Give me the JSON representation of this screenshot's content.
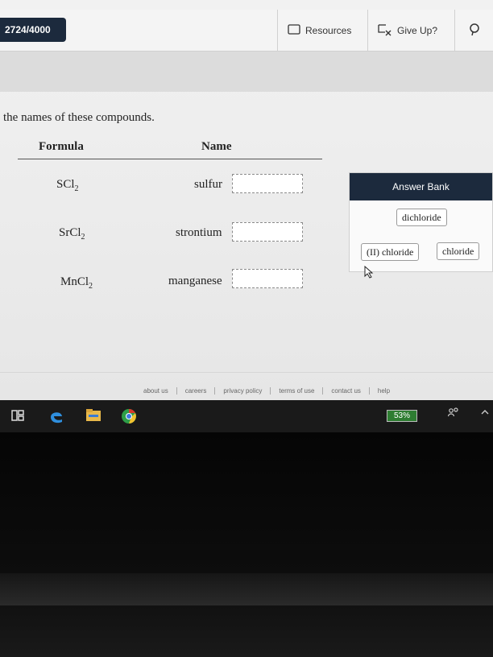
{
  "header": {
    "progress": "2724/4000",
    "resources_label": "Resources",
    "give_up_label": "Give Up?"
  },
  "instruction": "the names of these compounds.",
  "table": {
    "formula_header": "Formula",
    "name_header": "Name",
    "rows": [
      {
        "formula_base": "SCl",
        "formula_sub": "2",
        "name_prefix": "sulfur"
      },
      {
        "formula_base": "SrCl",
        "formula_sub": "2",
        "name_prefix": "strontium"
      },
      {
        "formula_base": "MnCl",
        "formula_sub": "2",
        "name_prefix": "manganese"
      }
    ]
  },
  "answer_bank": {
    "title": "Answer Bank",
    "items": [
      "dichloride",
      "(II) chloride",
      "chloride"
    ]
  },
  "footer": {
    "links": [
      "about us",
      "careers",
      "privacy policy",
      "terms of use",
      "contact us",
      "help"
    ]
  },
  "taskbar": {
    "battery": "53%"
  },
  "colors": {
    "accent_navy": "#1c2a3d",
    "battery_green": "#2e7d32"
  },
  "icons": [
    "folder-icon",
    "give-up-icon",
    "hint-icon",
    "task-view-icon",
    "edge-icon",
    "file-explorer-icon",
    "chrome-icon",
    "people-icon",
    "chevron-up-icon"
  ]
}
